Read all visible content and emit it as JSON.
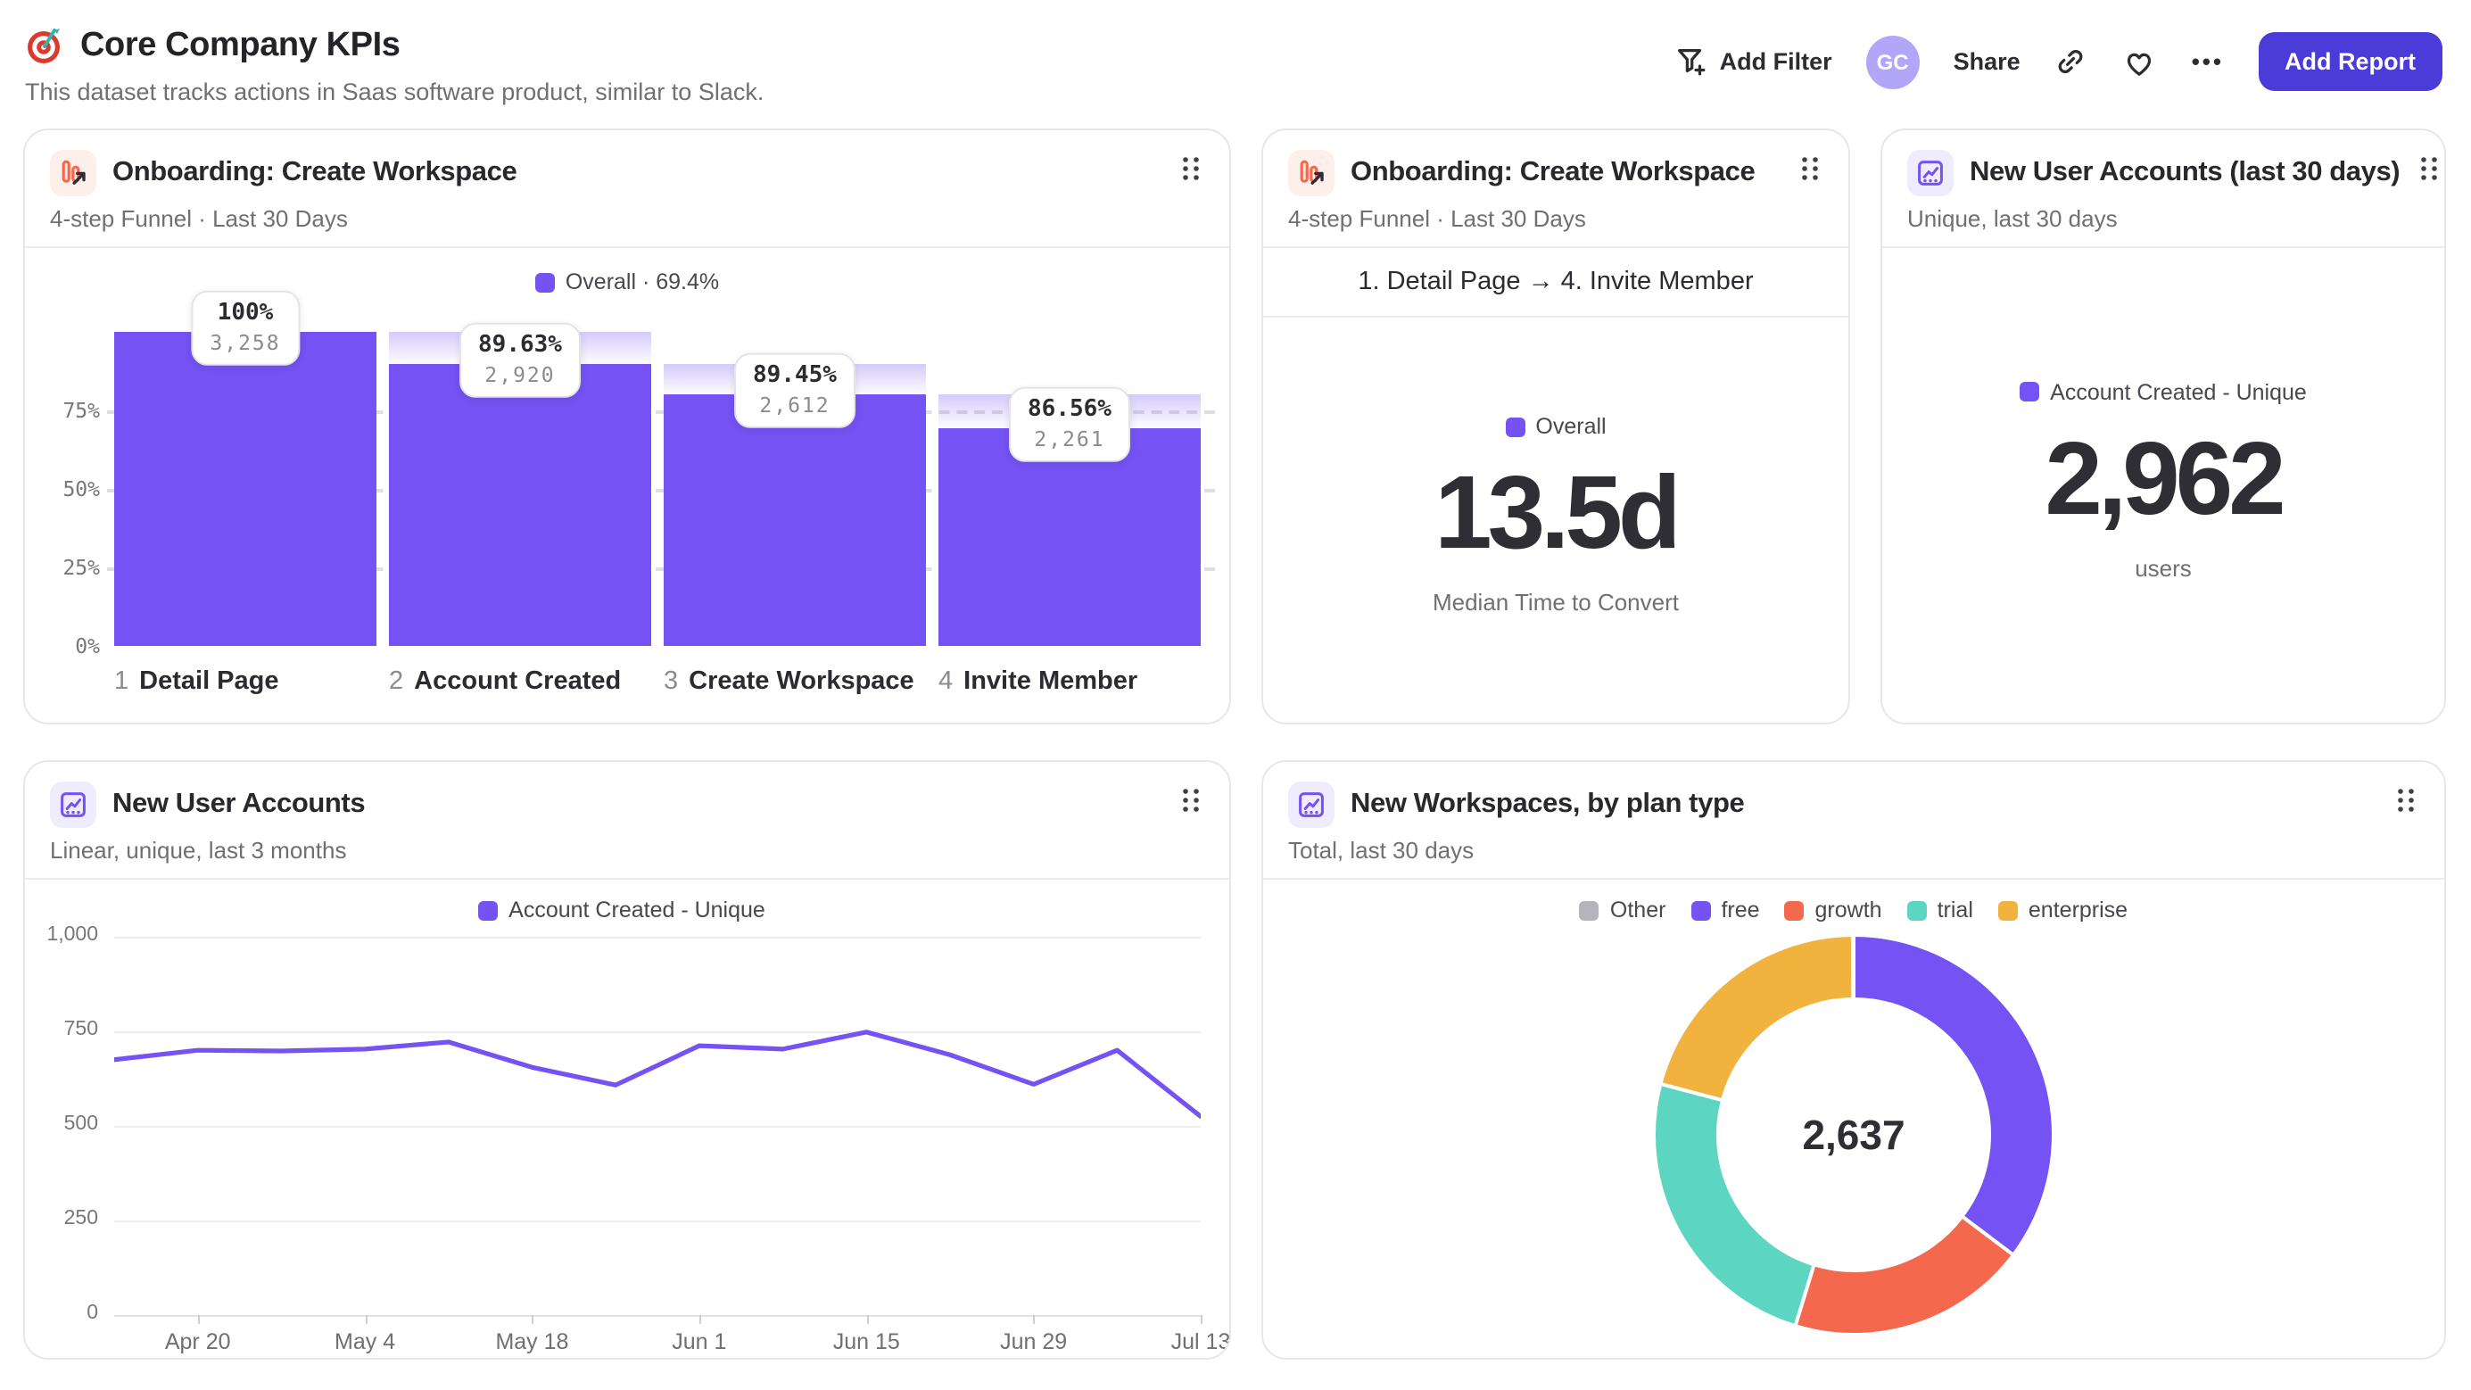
{
  "colors": {
    "accent_purple": "#7452F4",
    "coral": "#F4694E",
    "teal": "#5CD6C0",
    "amber": "#F2B23E",
    "gray_other": "#B4B4BA",
    "button_indigo": "#4B3BD8",
    "avatar_lavender": "#B2A6F8"
  },
  "header": {
    "title": "Core Company KPIs",
    "subtitle": "This dataset tracks actions in Saas software product, similar to Slack.",
    "add_filter": "Add Filter",
    "avatar_initials": "GC",
    "share": "Share",
    "more": "•••",
    "add_report": "Add Report"
  },
  "cards": {
    "funnel": {
      "title": "Onboarding: Create Workspace",
      "subtitle": "4-step Funnel · Last 30 Days",
      "legend": "Overall · 69.4%",
      "y_ticks": [
        {
          "label": "75%",
          "value": 75
        },
        {
          "label": "50%",
          "value": 50
        },
        {
          "label": "25%",
          "value": 25
        },
        {
          "label": "0%",
          "value": 0
        }
      ],
      "steps": [
        {
          "index": "1",
          "name": "Detail Page",
          "conversion": "100%",
          "count": "3,258",
          "height_pct": 100
        },
        {
          "index": "2",
          "name": "Account Created",
          "conversion": "89.63%",
          "count": "2,920",
          "height_pct": 89.63
        },
        {
          "index": "3",
          "name": "Create Workspace",
          "conversion": "89.45%",
          "count": "2,612",
          "height_pct": 80.17
        },
        {
          "index": "4",
          "name": "Invite Member",
          "conversion": "86.56%",
          "count": "2,261",
          "height_pct": 69.4
        }
      ]
    },
    "median_time": {
      "title": "Onboarding: Create Workspace",
      "subtitle": "4-step Funnel · Last 30 Days",
      "range": "1. Detail Page → 4. Invite Member",
      "legend": "Overall",
      "value": "13.5d",
      "caption": "Median Time to Convert"
    },
    "new_accounts": {
      "title": "New User Accounts (last 30 days)",
      "subtitle": "Unique, last 30 days",
      "legend": "Account Created - Unique",
      "value": "2,962",
      "caption": "users"
    },
    "accounts_trend": {
      "title": "New User Accounts",
      "subtitle": "Linear, unique, last 3 months",
      "legend": "Account Created - Unique",
      "y_max": 1000,
      "y_ticks": [
        {
          "label": "1,000",
          "value": 1000
        },
        {
          "label": "750",
          "value": 750
        },
        {
          "label": "500",
          "value": 500
        },
        {
          "label": "250",
          "value": 250
        },
        {
          "label": "0",
          "value": 0
        }
      ],
      "values": [
        675,
        700,
        698,
        703,
        722,
        655,
        608,
        712,
        703,
        748,
        688,
        610,
        700,
        525
      ],
      "x_ticks": [
        {
          "label": "Apr 20",
          "index": 1
        },
        {
          "label": "May 4",
          "index": 3
        },
        {
          "label": "May 18",
          "index": 5
        },
        {
          "label": "Jun 1",
          "index": 7
        },
        {
          "label": "Jun 15",
          "index": 9
        },
        {
          "label": "Jun 29",
          "index": 11
        },
        {
          "label": "Jul 13",
          "index": 13
        }
      ]
    },
    "workspaces_plan": {
      "title": "New Workspaces, by plan type",
      "subtitle": "Total, last 30 days",
      "total": "2,637",
      "slices": [
        {
          "label": "Other",
          "value": 2,
          "color": "#B4B4BA"
        },
        {
          "label": "free",
          "value": 930,
          "color": "#7452F4"
        },
        {
          "label": "growth",
          "value": 513,
          "color": "#F4694E"
        },
        {
          "label": "trial",
          "value": 643,
          "color": "#5CD6C0"
        },
        {
          "label": "enterprise",
          "value": 549,
          "color": "#F2B23E"
        }
      ]
    }
  },
  "chart_data": [
    {
      "type": "bar",
      "subtype": "funnel",
      "title": "Onboarding: Create Workspace",
      "legend": "Overall · 69.4%",
      "categories": [
        "1 Detail Page",
        "2 Account Created",
        "3 Create Workspace",
        "4 Invite Member"
      ],
      "counts": [
        3258,
        2920,
        2612,
        2261
      ],
      "step_conversion_pct": [
        100,
        89.63,
        89.45,
        86.56
      ],
      "pct_of_first_step": [
        100,
        89.63,
        80.17,
        69.4
      ],
      "ylim": [
        0,
        100
      ]
    },
    {
      "type": "table",
      "subtype": "metric",
      "title": "Onboarding: Create Workspace",
      "series": "Overall",
      "value": "13.5d",
      "label": "Median Time to Convert"
    },
    {
      "type": "table",
      "subtype": "metric",
      "title": "New User Accounts (last 30 days)",
      "series": "Account Created - Unique",
      "value": 2962,
      "label": "users"
    },
    {
      "type": "line",
      "title": "New User Accounts",
      "series": [
        {
          "name": "Account Created - Unique",
          "values": [
            675,
            700,
            698,
            703,
            722,
            655,
            608,
            712,
            703,
            748,
            688,
            610,
            700,
            525
          ]
        }
      ],
      "x_tick_labels": [
        "Apr 20",
        "May 4",
        "May 18",
        "Jun 1",
        "Jun 15",
        "Jun 29",
        "Jul 13"
      ],
      "ylim": [
        0,
        1000
      ],
      "grid": true,
      "legend_position": "top"
    },
    {
      "type": "pie",
      "subtype": "donut",
      "title": "New Workspaces, by plan type",
      "total": 2637,
      "labels": [
        "Other",
        "free",
        "growth",
        "trial",
        "enterprise"
      ],
      "values": [
        2,
        930,
        513,
        643,
        549
      ],
      "colors": [
        "#B4B4BA",
        "#7452F4",
        "#F4694E",
        "#5CD6C0",
        "#F2B23E"
      ],
      "center_label": "2,637",
      "legend_position": "top"
    }
  ]
}
